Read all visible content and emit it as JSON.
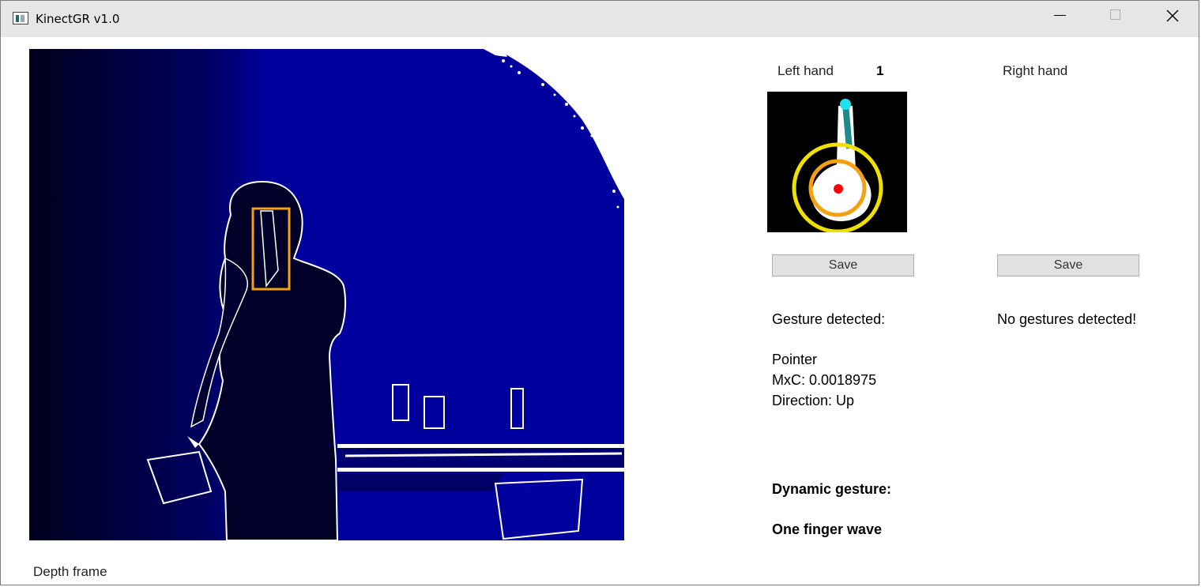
{
  "window": {
    "title": "KinectGR v1.0"
  },
  "depth": {
    "caption": "Depth frame",
    "colors": {
      "background": "#00009a",
      "person": "#000030",
      "edge": "#ffffff",
      "roi": "#f5a010"
    }
  },
  "left_hand": {
    "label": "Left hand",
    "count": "1",
    "save_label": "Save"
  },
  "right_hand": {
    "label": "Right hand",
    "save_label": "Save",
    "status": "No gestures detected!"
  },
  "gesture": {
    "heading": "Gesture detected:",
    "name": "Pointer",
    "mxc": "MxC: 0.0018975",
    "direction": "Direction: Up"
  },
  "dynamic": {
    "heading": "Dynamic gesture:",
    "value": "One finger wave"
  }
}
